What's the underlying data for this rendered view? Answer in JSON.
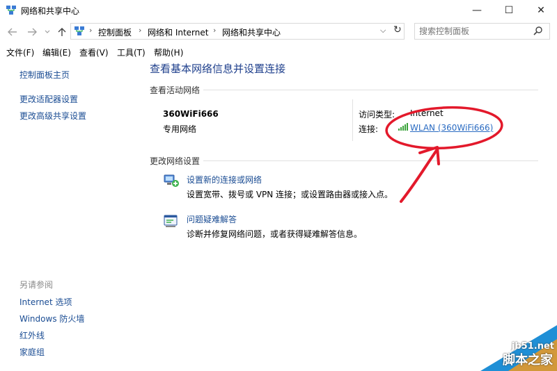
{
  "window": {
    "title": "网络和共享中心",
    "minimize": "—",
    "maximize": "☐",
    "close": "✕"
  },
  "address": {
    "crumbs": [
      "控制面板",
      "网络和 Internet",
      "网络和共享中心"
    ],
    "separator": "›",
    "search_placeholder": "搜索控制面板"
  },
  "menu": [
    "文件(F)",
    "编辑(E)",
    "查看(V)",
    "工具(T)",
    "帮助(H)"
  ],
  "sidebar": {
    "links": [
      "控制面板主页",
      "更改适配器设置",
      "更改高级共享设置"
    ],
    "see_also_heading": "另请参阅",
    "see_also": [
      "Internet 选项",
      "Windows 防火墙",
      "红外线",
      "家庭组"
    ]
  },
  "main": {
    "title": "查看基本网络信息并设置连接",
    "active_heading": "查看活动网络",
    "network_name": "360WiFi666",
    "network_category": "专用网络",
    "access_type_label": "访问类型:",
    "access_type_value": "Internet",
    "connection_label": "连接:",
    "connection_value": "WLAN (360WiFi666)",
    "change_heading": "更改网络设置",
    "tasks": [
      {
        "title": "设置新的连接或网络",
        "desc": "设置宽带、拨号或 VPN 连接；或设置路由器或接入点。"
      },
      {
        "title": "问题疑难解答",
        "desc": "诊断并修复网络问题，或者获得疑难解答信息。"
      }
    ]
  },
  "watermark": {
    "site": "jb51.net",
    "name": "脚本之家"
  },
  "colors": {
    "link": "#1a4c93",
    "title": "#1e3f8c",
    "annotation": "#e3192b",
    "watermark": "#1f8fd6"
  }
}
